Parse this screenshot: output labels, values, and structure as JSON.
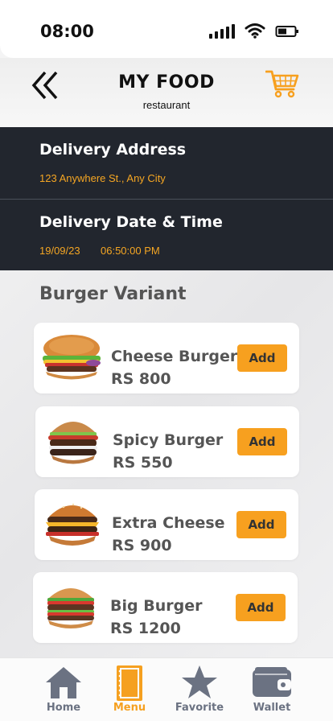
{
  "status": {
    "time": "08:00"
  },
  "header": {
    "title": "MY FOOD",
    "subtitle": "restaurant"
  },
  "delivery": {
    "address_label": "Delivery Address",
    "address_value": "123 Anywhere St., Any City",
    "datetime_label": "Delivery Date & Time",
    "date_value": "19/09/23",
    "time_value": "06:50:00 PM"
  },
  "section": {
    "title": "Burger Variant"
  },
  "items": [
    {
      "name": "Cheese Burger",
      "price": "RS 800",
      "add_label": "Add"
    },
    {
      "name": "Spicy Burger",
      "price": "RS 550",
      "add_label": "Add"
    },
    {
      "name": "Extra Cheese",
      "price": "RS 900",
      "add_label": "Add"
    },
    {
      "name": "Big Burger",
      "price": "RS 1200",
      "add_label": "Add"
    }
  ],
  "nav": [
    {
      "label": "Home",
      "icon": "home-icon"
    },
    {
      "label": "Menu",
      "icon": "menu-icon",
      "active": true
    },
    {
      "label": "Favorite",
      "icon": "star-icon"
    },
    {
      "label": "Wallet",
      "icon": "wallet-icon"
    }
  ],
  "colors": {
    "accent": "#f7a01f",
    "dark_panel": "#22262e",
    "nav_inactive": "#6b7282"
  }
}
